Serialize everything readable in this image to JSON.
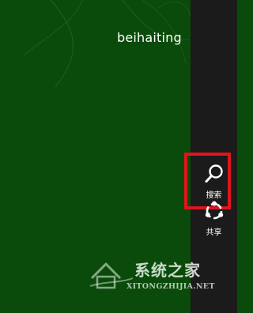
{
  "user": {
    "name": "beihaiting"
  },
  "charms": {
    "search_label": "搜索",
    "search_icon": "search-icon",
    "share_label": "共享",
    "share_icon": "share-icon"
  },
  "watermark": {
    "title": "系统之家",
    "url": "XITONGZHIJIA.NET"
  },
  "colors": {
    "background": "#0a4a0a",
    "charms_bar": "#1b1b1b",
    "highlight": "#e0141e"
  }
}
